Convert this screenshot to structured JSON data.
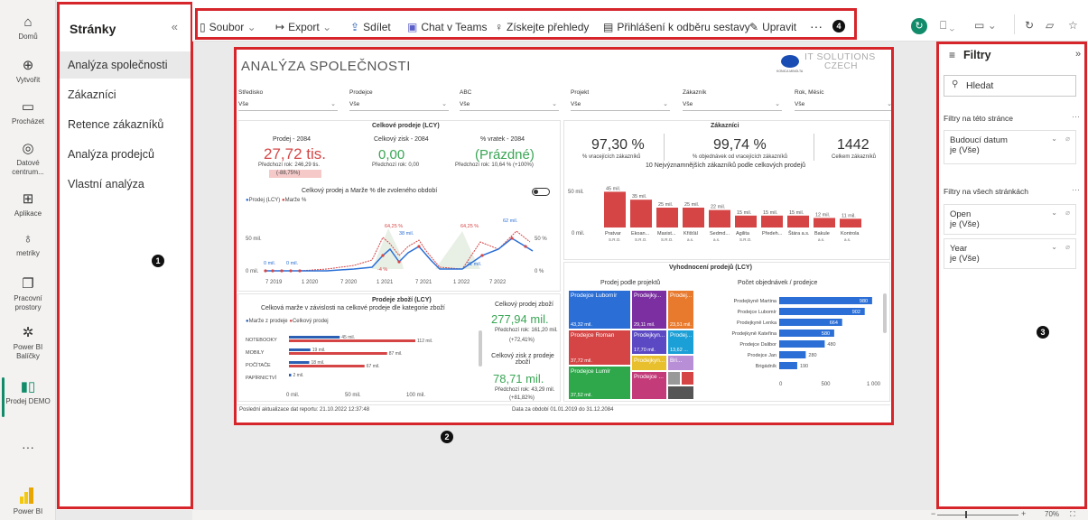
{
  "nav": {
    "items": [
      {
        "label": "Domů",
        "icon": "home-icon",
        "glyph": "⌂"
      },
      {
        "label": "Vytvořit",
        "icon": "plus-circle-icon",
        "glyph": "⊕"
      },
      {
        "label": "Procházet",
        "icon": "folder-icon",
        "glyph": "▭"
      },
      {
        "label": "Datové centrum...",
        "icon": "data-hub-icon",
        "glyph": "◎"
      },
      {
        "label": "Aplikace",
        "icon": "apps-icon",
        "glyph": "⊞"
      },
      {
        "label": "metriky",
        "icon": "trophy-icon",
        "glyph": "♁"
      },
      {
        "label": "Pracovní prostory",
        "icon": "workspaces-icon",
        "glyph": "❐"
      },
      {
        "label": "Power BI Balíčky",
        "icon": "packages-icon",
        "glyph": "✲"
      },
      {
        "label": "Prodej DEMO",
        "icon": "report-icon",
        "glyph": "▮▯"
      }
    ],
    "more": "···",
    "brand": "Power BI"
  },
  "pages": {
    "title": "Stránky",
    "items": [
      "Analýza společnosti",
      "Zákazníci",
      "Retence zákazníků",
      "Analýza prodejců",
      "Vlastní analýza"
    ]
  },
  "toolbar": {
    "file": "Soubor",
    "export": "Export",
    "share": "Sdílet",
    "teams": "Chat v Teams",
    "insights": "Získejte přehledy",
    "subscribe": "Přihlášení k odběru sestavy",
    "edit": "Upravit",
    "more": "···"
  },
  "badges": [
    "1",
    "2",
    "3",
    "4"
  ],
  "report": {
    "title": "ANALÝZA SPOLEČNOSTI",
    "logo_line1": "IT SOLUTIONS",
    "logo_line2": "CZECH",
    "logo_small": "KONICA MINOLTA",
    "slicers": [
      {
        "label": "Středisko",
        "value": "Vše"
      },
      {
        "label": "Prodejce",
        "value": "Vše"
      },
      {
        "label": "ABC",
        "value": "Vše"
      },
      {
        "label": "Projekt",
        "value": "Vše"
      },
      {
        "label": "Zákazník",
        "value": "Vše"
      },
      {
        "label": "Rok, Měsíc",
        "value": "Vše"
      }
    ],
    "sales": {
      "header": "Celkové prodeje (LCY)",
      "k1_label": "Prodej - 2084",
      "k1_value": "27,72 tis.",
      "k1_prev": "Předchozí rok: 246,29 tis.",
      "k1_delta": "(-88,75%)",
      "k2_label": "Celkový zisk - 2084",
      "k2_value": "0,00",
      "k2_prev": "Předchozí rok: 0,00",
      "k3_label": "% vratek - 2084",
      "k3_value": "(Prázdné)",
      "k3_prev": "Předchozí rok: 10,64 % (+100%)",
      "chart_title": "Celkový prodej a Marže % dle zvoleného období",
      "legend1": "Prodej (LCY)",
      "legend2": "Marže %",
      "y_top": "50 mil.",
      "y_bottom": "0 mil.",
      "y2_top": "50 %",
      "y2_bottom": "0 %",
      "x_labels": [
        "7 2019",
        "1 2020",
        "7 2020",
        "1 2021",
        "7 2021",
        "1 2022",
        "7 2022"
      ],
      "annotations": [
        "64,25 %",
        "64,25 %",
        "62 mil.",
        "38 mil.",
        "21 mil.",
        "0 mil.",
        "0 mil.",
        "-4 %"
      ]
    },
    "goods": {
      "title": "Prodeje zboží (LCY)",
      "subtitle": "Celková marže v závislosti na celkové prodeje dle kategorie zboží",
      "legend1": "Marže z prodeje",
      "legend2": "Celkový prodej",
      "categories": [
        "NOTEBOOKY",
        "MOBILY",
        "POČÍTAČE",
        "PAPÍRNICTVÍ"
      ],
      "axis": [
        "0 mil.",
        "50 mil.",
        "100 mil."
      ],
      "kpi1_label": "Celkový prodej zboží",
      "kpi1_value": "277,94 mil.",
      "kpi1_prev": "Předchozí rok: 161,20 mil.",
      "kpi1_delta": "(+72,41%)",
      "kpi2_label": "Celkový zisk z prodeje zboží",
      "kpi2_value": "78,71 mil.",
      "kpi2_prev": "Předchozí rok: 43,29 mil.",
      "kpi2_delta": "(+81,82%)"
    },
    "customers": {
      "header": "Zákazníci",
      "k1_value": "97,30 %",
      "k1_label": "% vracejících zákazníků",
      "k2_value": "99,74 %",
      "k2_label": "% objednávek od vracejících zákazníků",
      "k3_value": "1442",
      "k3_label": "Celkem zákazníků",
      "top_title": "10 Nejvýznamnějších zákazníků podle celkových prodejů",
      "y_top": "50 mil.",
      "y_bottom": "0 mil."
    },
    "sellers": {
      "header": "Vyhodnocení prodejů (LCY)",
      "treemap_title": "Prodej podle projektů",
      "tiles": [
        {
          "label": "Prodejce Lubomír",
          "value": "43,32 mil."
        },
        {
          "label": "Prodejky...",
          "value": "29,11 mil."
        },
        {
          "label": "Prodej...",
          "value": "23,51 mil."
        },
        {
          "label": "Prodejce Roman",
          "value": "37,72 mil."
        },
        {
          "label": "Prodejkyn...",
          "value": "17,70 mil."
        },
        {
          "label": "Prodej...",
          "value": "13,62 ..."
        },
        {
          "label": "Prodejkyn...",
          "value": ""
        },
        {
          "label": "Bri...",
          "value": ""
        },
        {
          "label": "Prodejce Lumír",
          "value": "37,52 mil."
        },
        {
          "label": "Prodejce ...",
          "value": ""
        }
      ],
      "bar_title": "Počet objednávek / prodejce",
      "axis": [
        "0",
        "500",
        "1 000"
      ]
    },
    "footer_left": "Poslední aktualizace dat reportu: 21.10.2022 12:37:48",
    "footer_right": "Data za období 01.01.2019 do 31.12.2084"
  },
  "filters": {
    "title": "Filtry",
    "search_placeholder": "Hledat",
    "section_page": "Filtry na této stránce",
    "section_all": "Filtry na všech stránkách",
    "page_filters": [
      {
        "name": "Budoucí datum",
        "value": "je (Vše)"
      }
    ],
    "all_filters": [
      {
        "name": "Open",
        "value": "je (Vše)"
      },
      {
        "name": "Year",
        "value": "je (Vše)"
      }
    ]
  },
  "status": {
    "zoom": "70%"
  },
  "chart_data": [
    {
      "type": "bar",
      "title": "10 Nejvýznamnějších zákazníků podle celkových prodejů",
      "categories": [
        "Pratvar",
        "Ekoan...",
        "Maxist...",
        "Křišťál",
        "Sedmd...",
        "Agilita",
        "Předeh...",
        "Štára a.s.",
        "Bakule",
        "Kontrola"
      ],
      "category_sublabels": [
        "S.R.O.",
        "S.R.O.",
        "S.R.O.",
        "a.s.",
        "a.s.",
        "S.R.O.",
        "",
        "",
        "a.s.",
        "a.s."
      ],
      "values": [
        45,
        35,
        25,
        25,
        22,
        15,
        15,
        15,
        12,
        11
      ],
      "data_labels": [
        "45 mil.",
        "35 mil.",
        "25 mil.",
        "25 mil.",
        "22 mil.",
        "15 mil.",
        "15 mil.",
        "15 mil.",
        "12 mil.",
        "11 mil."
      ],
      "ylim": [
        0,
        50
      ],
      "color": "#d64545"
    },
    {
      "type": "bar",
      "title": "Počet objednávek / prodejce",
      "orientation": "horizontal",
      "categories": [
        "Prodejkyně Martina",
        "Prodejce Lubomír",
        "Prodejkyně Lenka",
        "Prodejkyně Kateřina",
        "Prodejce Dalibor",
        "Prodejce Jan",
        "Brigádník"
      ],
      "values": [
        980,
        902,
        664,
        580,
        480,
        280,
        190
      ],
      "xlim": [
        0,
        1000
      ],
      "color": "#2b6fd6"
    },
    {
      "type": "bar",
      "title": "Prodeje zboží (LCY)",
      "orientation": "horizontal",
      "categories": [
        "NOTEBOOKY",
        "MOBILY",
        "POČÍTAČE",
        "PAPÍRNICTVÍ"
      ],
      "series": [
        {
          "name": "Marže z prodeje",
          "values": [
            45,
            19,
            18,
            2
          ],
          "labels": [
            "45 mil.",
            "19 mil.",
            "18 mil.",
            "2 mil."
          ],
          "color": "#2b5fb3"
        },
        {
          "name": "Celkový prodej",
          "values": [
            112,
            87,
            67,
            0
          ],
          "labels": [
            "112 mil.",
            "87 mil.",
            "67 mil.",
            ""
          ],
          "color": "#d64545"
        }
      ],
      "xlim": [
        0,
        120
      ]
    },
    {
      "type": "line",
      "title": "Celkový prodej a Marže % dle zvoleného období",
      "x": [
        "7 2019",
        "1 2020",
        "7 2020",
        "1 2021",
        "7 2021",
        "1 2022",
        "7 2022"
      ],
      "series": [
        {
          "name": "Prodej (LCY)",
          "values": [
            0,
            0,
            2,
            30,
            38,
            5,
            62
          ],
          "color": "#2b6fd6"
        },
        {
          "name": "Marže %",
          "values": [
            0,
            0,
            5,
            45,
            60,
            10,
            55
          ],
          "color": "#d64545"
        }
      ]
    }
  ]
}
